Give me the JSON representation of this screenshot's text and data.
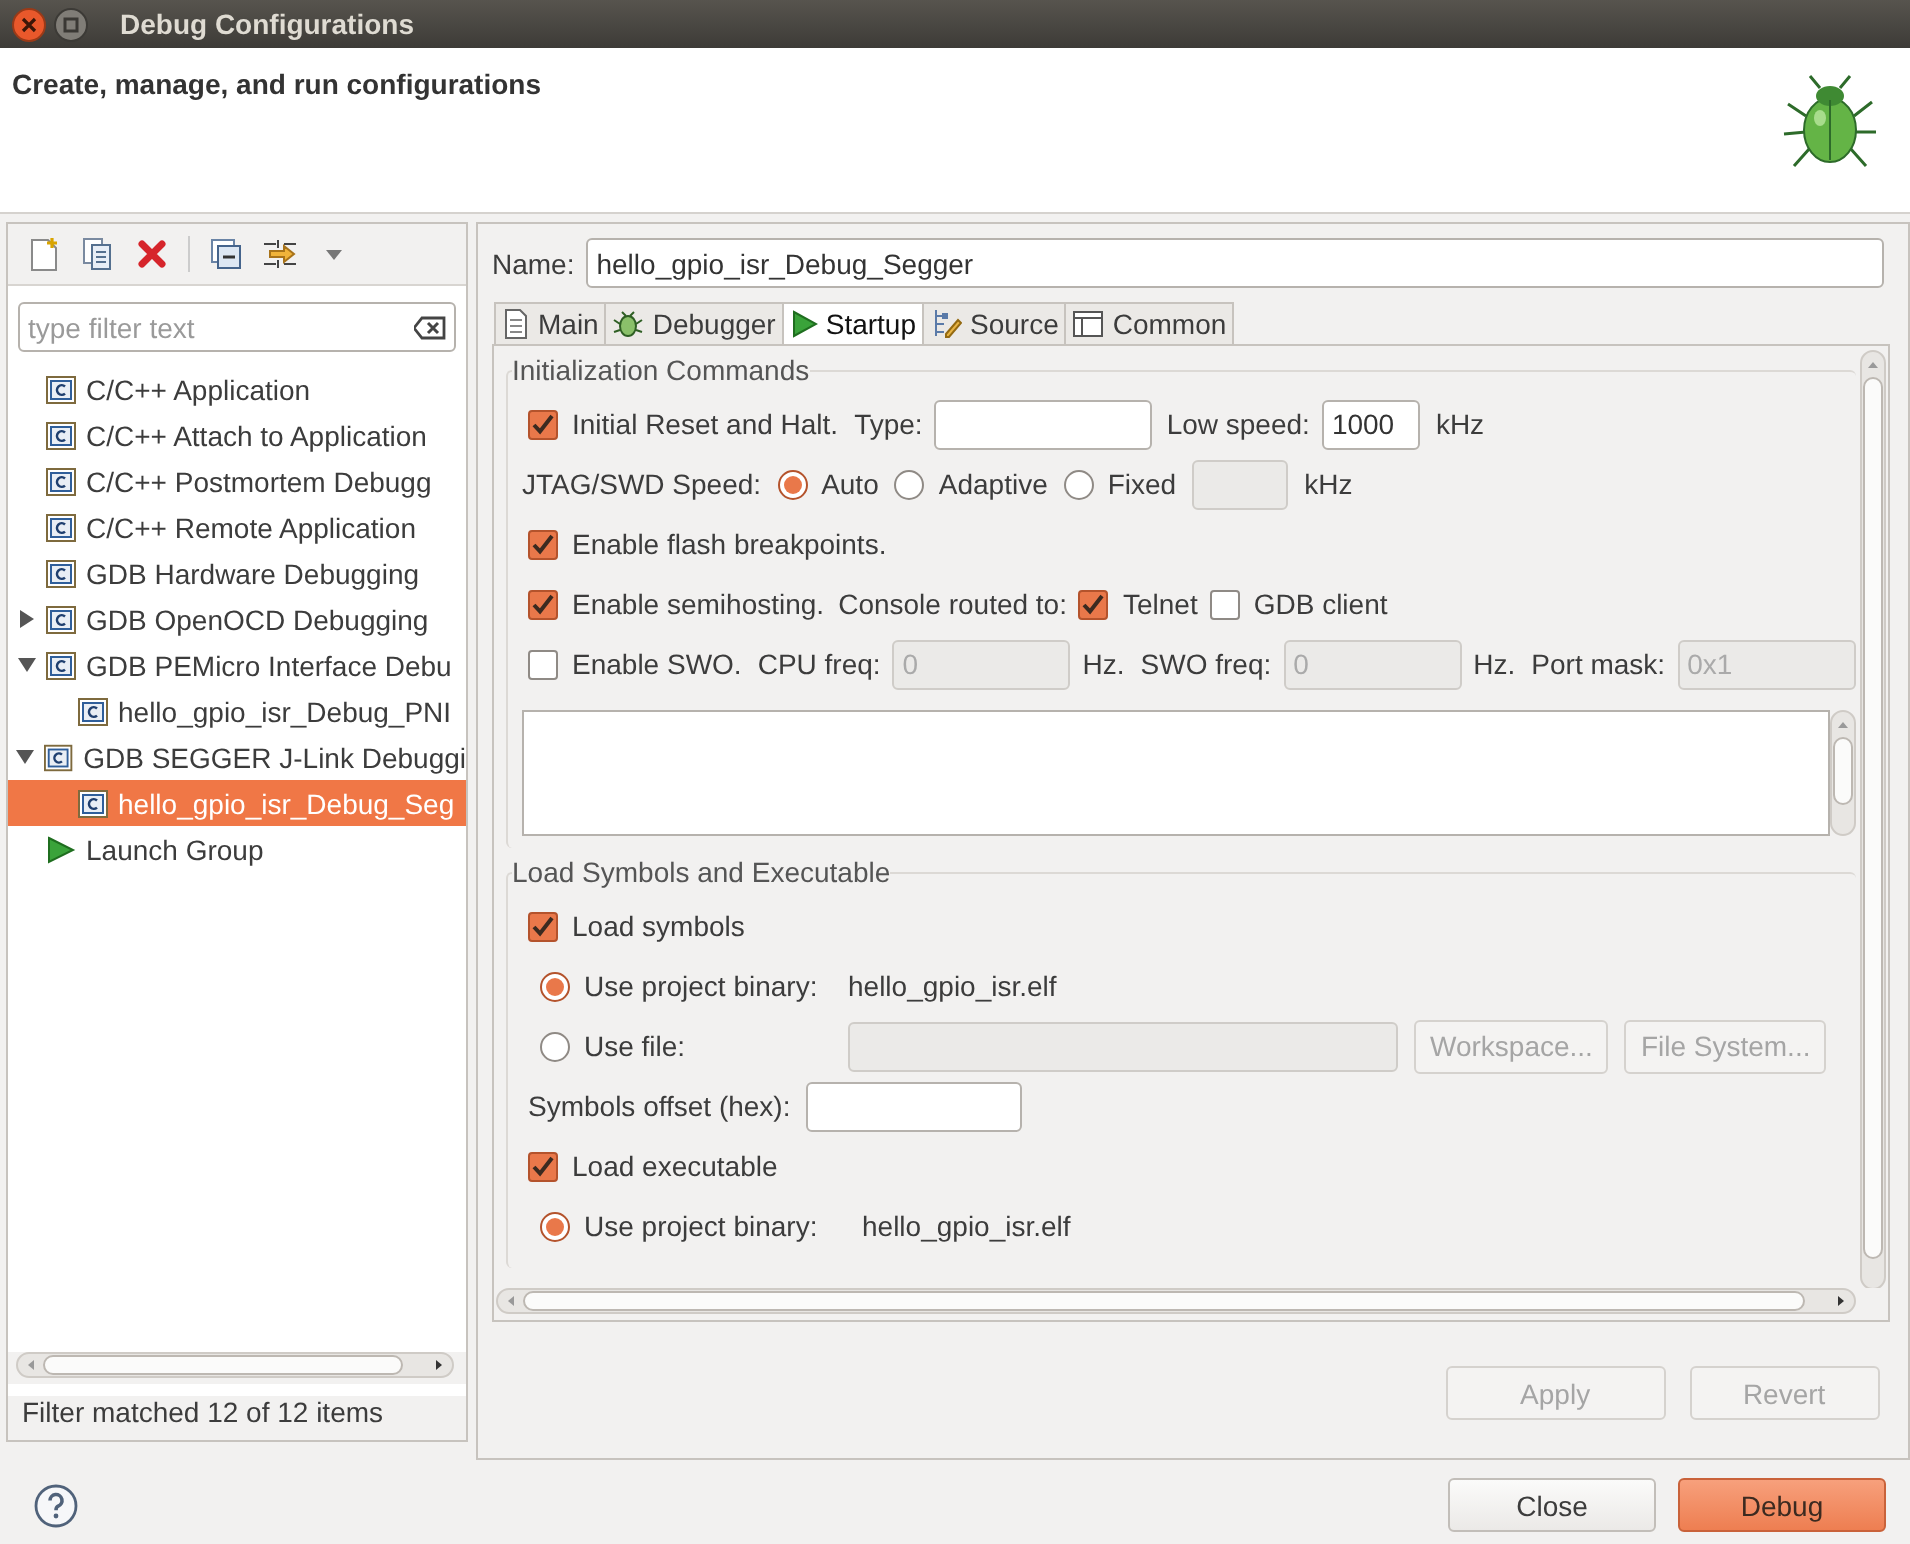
{
  "window": {
    "title": "Debug Configurations"
  },
  "header": {
    "title": "Create, manage, and run configurations"
  },
  "sidebar": {
    "filter": {
      "placeholder": "type filter text"
    },
    "items": [
      {
        "label": "C/C++ Application",
        "kind": "config",
        "selected": false
      },
      {
        "label": "C/C++ Attach to Application",
        "kind": "config",
        "selected": false
      },
      {
        "label": "C/C++ Postmortem Debugg",
        "kind": "config",
        "selected": false
      },
      {
        "label": "C/C++ Remote Application",
        "kind": "config",
        "selected": false
      },
      {
        "label": "GDB Hardware Debugging",
        "kind": "config",
        "selected": false
      },
      {
        "label": "GDB OpenOCD Debugging",
        "kind": "config",
        "selected": false,
        "expanded": false
      },
      {
        "label": "GDB PEMicro Interface Debu",
        "kind": "config",
        "selected": false,
        "expanded": true,
        "children": [
          {
            "label": "hello_gpio_isr_Debug_PNI",
            "kind": "config",
            "selected": false
          }
        ]
      },
      {
        "label": "GDB SEGGER J-Link Debuggi",
        "kind": "config",
        "selected": false,
        "expanded": true,
        "children": [
          {
            "label": "hello_gpio_isr_Debug_Seg",
            "kind": "config",
            "selected": true
          }
        ]
      },
      {
        "label": "Launch Group",
        "kind": "launch_group",
        "selected": false
      }
    ],
    "status": "Filter matched 12 of 12 items"
  },
  "editor": {
    "name": {
      "label": "Name:",
      "value": "hello_gpio_isr_Debug_Segger"
    },
    "tabs": [
      {
        "label": "Main",
        "selected": false
      },
      {
        "label": "Debugger",
        "selected": false
      },
      {
        "label": "Startup",
        "selected": true
      },
      {
        "label": "Source",
        "selected": false
      },
      {
        "label": "Common",
        "selected": false
      }
    ],
    "init": {
      "title": "Initialization Commands",
      "reset": {
        "label": "Initial Reset and Halt.",
        "checked": true
      },
      "type": {
        "label": "Type:"
      },
      "low_speed": {
        "label": "Low speed:",
        "value": "1000",
        "unit": "kHz"
      },
      "jtag": {
        "label": "JTAG/SWD Speed:",
        "options": [
          {
            "label": "Auto",
            "selected": true
          },
          {
            "label": "Adaptive",
            "selected": false
          },
          {
            "label": "Fixed",
            "selected": false
          }
        ],
        "unit": "kHz",
        "field": {
          "disabled": true
        }
      },
      "flash": {
        "label": "Enable flash breakpoints.",
        "checked": true
      },
      "semihosting": {
        "label": "Enable semihosting.",
        "checked": true
      },
      "console": {
        "label": "Console routed to:",
        "options": [
          {
            "label": "Telnet",
            "checked": true
          },
          {
            "label": "GDB client",
            "checked": false
          }
        ]
      },
      "swo": {
        "label": "Enable SWO.",
        "checked": false
      },
      "swo_fields": [
        {
          "label": "CPU freq:",
          "value": "0",
          "unit": "Hz.",
          "disabled": true
        },
        {
          "label": "SWO freq:",
          "value": "0",
          "unit": "Hz.",
          "disabled": true
        },
        {
          "label": "Port mask:",
          "value": "0x1",
          "disabled": true
        }
      ]
    },
    "load": {
      "title": "Load Symbols and Executable",
      "sections": [
        {
          "label": "Load symbols",
          "checked": true,
          "sources": [
            {
              "label": "Use project binary:",
              "value": "hello_gpio_isr.elf",
              "selected": true
            },
            {
              "label": "Use file:",
              "selected": false,
              "field": {
                "disabled": true
              },
              "buttons": [
                {
                  "label": "Workspace...",
                  "disabled": true
                },
                {
                  "label": "File System...",
                  "disabled": true
                }
              ]
            }
          ],
          "offset": {
            "label": "Symbols offset (hex):"
          }
        },
        {
          "label": "Load executable",
          "checked": true,
          "sources": [
            {
              "label": "Use project binary:",
              "value": "hello_gpio_isr.elf",
              "selected": true
            }
          ]
        }
      ]
    },
    "apply": {
      "label": "Apply",
      "disabled": true
    },
    "revert": {
      "label": "Revert",
      "disabled": true
    }
  },
  "footer": {
    "buttons": [
      {
        "label": "Close",
        "kind": "normal"
      },
      {
        "label": "Debug",
        "kind": "default"
      }
    ]
  }
}
